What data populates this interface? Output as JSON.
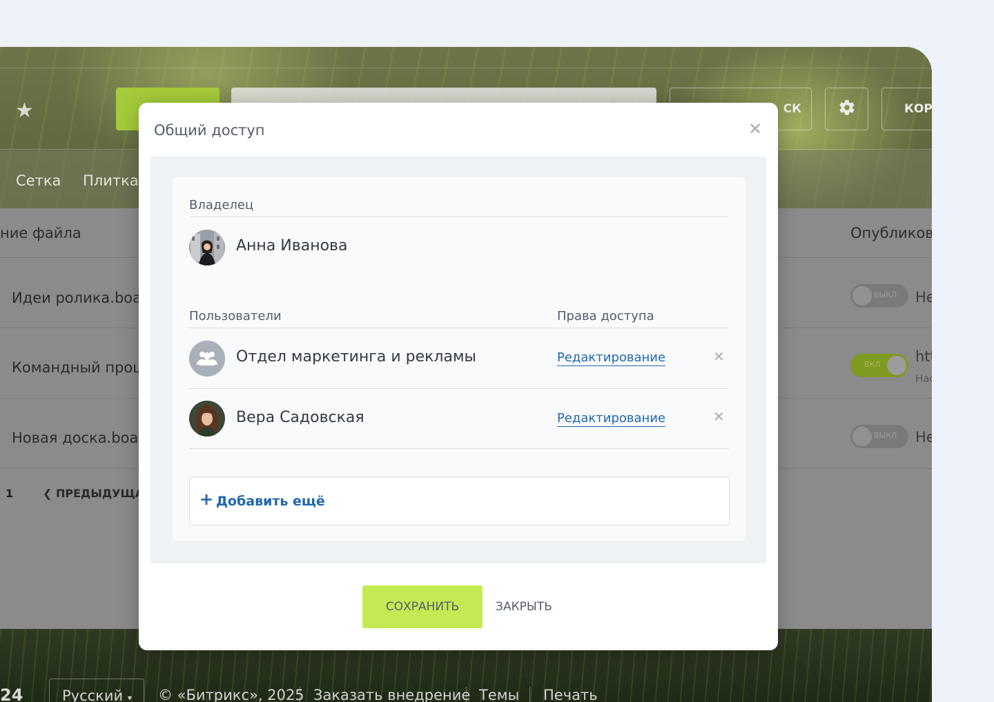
{
  "background": {
    "header": {
      "search_button_label": "СК",
      "cart_button_label": "КОРЗ"
    },
    "view_tabs": [
      "Сетка",
      "Плитка"
    ],
    "columns": {
      "name": "ние файла",
      "published": "Опубликова"
    },
    "rows": [
      {
        "name": "Идеи ролика.board",
        "toggle_label": "ВЫКЛ",
        "toggle_on": false,
        "extra": "Не"
      },
      {
        "name": "Командный процесс",
        "toggle_label": "ВКЛ",
        "toggle_on": true,
        "extra": "htt",
        "extra_sub": "Нас"
      },
      {
        "name": "Новая доска.board",
        "toggle_label": "ВЫКЛ",
        "toggle_on": false,
        "extra": "Не"
      }
    ],
    "pagination": {
      "page": "1",
      "prev_label": "ПРЕДЫДУЩАЯ"
    },
    "footer": {
      "logo": "24",
      "language": "Русский",
      "copyright": "© «Битрикс», 2025",
      "order_link": "Заказать внедрение",
      "themes_link": "Темы",
      "print_link": "Печать"
    }
  },
  "dialog": {
    "title": "Общий доступ",
    "owner_label": "Владелец",
    "owner_name": "Анна Иванова",
    "users_label": "Пользователи",
    "rights_label": "Права доступа",
    "entries": [
      {
        "name": "Отдел маркетинга и рекламы",
        "rights": "Редактирование",
        "type": "group"
      },
      {
        "name": "Вера Садовская",
        "rights": "Редактирование",
        "type": "user"
      }
    ],
    "add_more_label": "Добавить ещё",
    "save_label": "СОХРАНИТЬ",
    "close_label": "ЗАКРЫТЬ"
  },
  "colors": {
    "accent_green": "#c4ea53",
    "link_blue": "#2067b0",
    "text_dark": "#333a44"
  }
}
